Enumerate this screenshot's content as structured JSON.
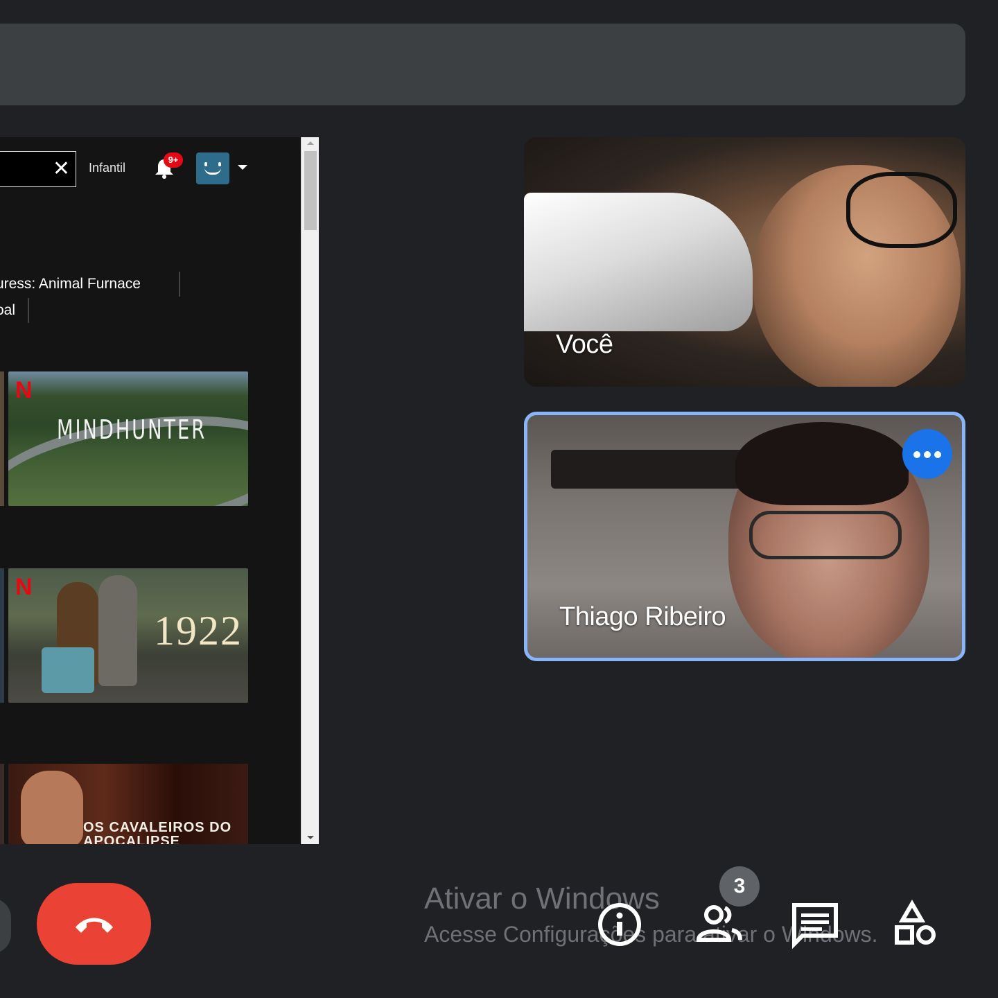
{
  "netflix": {
    "search_clear": "✕",
    "kids_label": "Infantil",
    "notifications_badge": "9+",
    "suggestion_line1": "uress: Animal Furnace",
    "suggestion_line2": "oal",
    "titles": [
      {
        "logo": "N",
        "title": "MINDHUNTER"
      },
      {
        "logo": "N",
        "title": "1922"
      },
      {
        "logo": "",
        "title": "OS CAVALEIROS DO APOCALIPSE"
      }
    ]
  },
  "participants": [
    {
      "name": "Você"
    },
    {
      "name": "Thiago Ribeiro"
    }
  ],
  "controls": {
    "participants_count": "3"
  },
  "watermark": {
    "line1": "Ativar o Windows",
    "line2": "Acesse Configurações para ativar o Windows."
  },
  "colors": {
    "background": "#202124",
    "hangup": "#ea4335",
    "active_speaker_border": "#8ab4f8",
    "more_button": "#1a73e8",
    "netflix_red": "#e50914"
  }
}
